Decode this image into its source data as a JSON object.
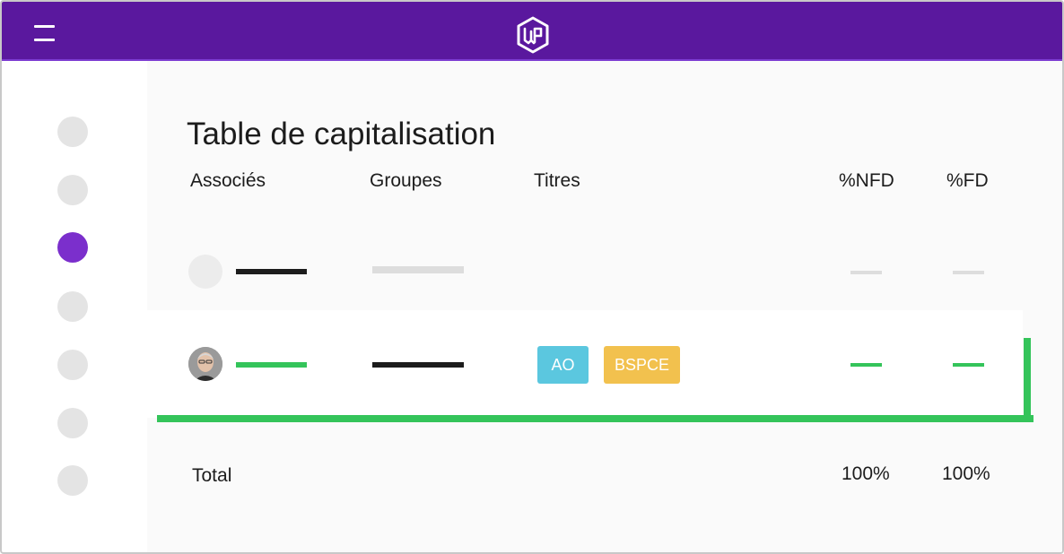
{
  "header": {
    "menu_icon": "hamburger-menu-icon",
    "logo_icon": "wp-hexagon-logo",
    "colors": {
      "background": "#5a189e",
      "border": "#7c3bd1"
    }
  },
  "sidebar": {
    "items": [
      {
        "state": "inactive"
      },
      {
        "state": "inactive"
      },
      {
        "state": "active",
        "color": "#7b2fcc"
      },
      {
        "state": "inactive"
      },
      {
        "state": "inactive"
      },
      {
        "state": "inactive"
      },
      {
        "state": "inactive"
      }
    ]
  },
  "main": {
    "title": "Table de capitalisation",
    "columns": {
      "associes": "Associés",
      "groupes": "Groupes",
      "titres": "Titres",
      "nfd": "%NFD",
      "fd": "%FD"
    },
    "rows": [
      {
        "state": "placeholder",
        "avatar": "empty-avatar-placeholder"
      },
      {
        "state": "highlighted",
        "avatar": "user-photo-avatar",
        "tags": [
          {
            "label": "AO",
            "color": "#5bc7df"
          },
          {
            "label": "BSPCE",
            "color": "#f2c14e"
          }
        ]
      }
    ],
    "total": {
      "label": "Total",
      "nfd": "100%",
      "fd": "100%"
    },
    "colors": {
      "accent_green": "#34c45a",
      "text": "#1c1c1c"
    }
  }
}
